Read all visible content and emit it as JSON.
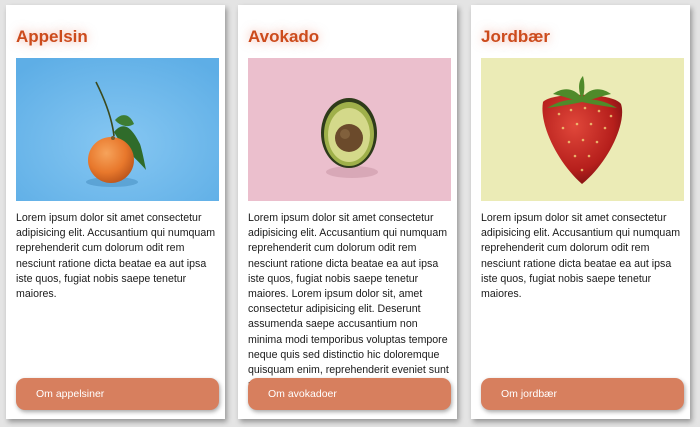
{
  "cards": [
    {
      "title": "Appelsin",
      "image_icon": "orange-icon",
      "image_background": "#6bb6ea",
      "text": "Lorem ipsum dolor sit amet consectetur adipisicing elit. Accusantium qui numquam reprehenderit cum dolorum odit rem nesciunt ratione dicta beatae ea aut ipsa iste quos, fugiat nobis saepe tenetur maiores.",
      "button_label": "Om appelsiner"
    },
    {
      "title": "Avokado",
      "image_icon": "avocado-icon",
      "image_background": "#ebbfcd",
      "text": "Lorem ipsum dolor sit amet consectetur adipisicing elit. Accusantium qui numquam reprehenderit cum dolorum odit rem nesciunt ratione dicta beatae ea aut ipsa iste quos, fugiat nobis saepe tenetur maiores. Lorem ipsum dolor sit, amet consectetur adipisicing elit. Deserunt assumenda saepe accusantium non minima modi temporibus voluptas tempore neque quis sed distinctio hic doloremque quisquam enim, reprehenderit eveniet sunt nemo?",
      "button_label": "Om avokadoer"
    },
    {
      "title": "Jordbær",
      "image_icon": "strawberry-icon",
      "image_background": "#ebebb6",
      "text": "Lorem ipsum dolor sit amet consectetur adipisicing elit. Accusantium qui numquam reprehenderit cum dolorum odit rem nesciunt ratione dicta beatae ea aut ipsa iste quos, fugiat nobis saepe tenetur maiores.",
      "button_label": "Om jordbær"
    }
  ],
  "colors": {
    "title": "#cc4b1c",
    "button": "#d77f5e",
    "page_background": "#e4e4e4"
  }
}
